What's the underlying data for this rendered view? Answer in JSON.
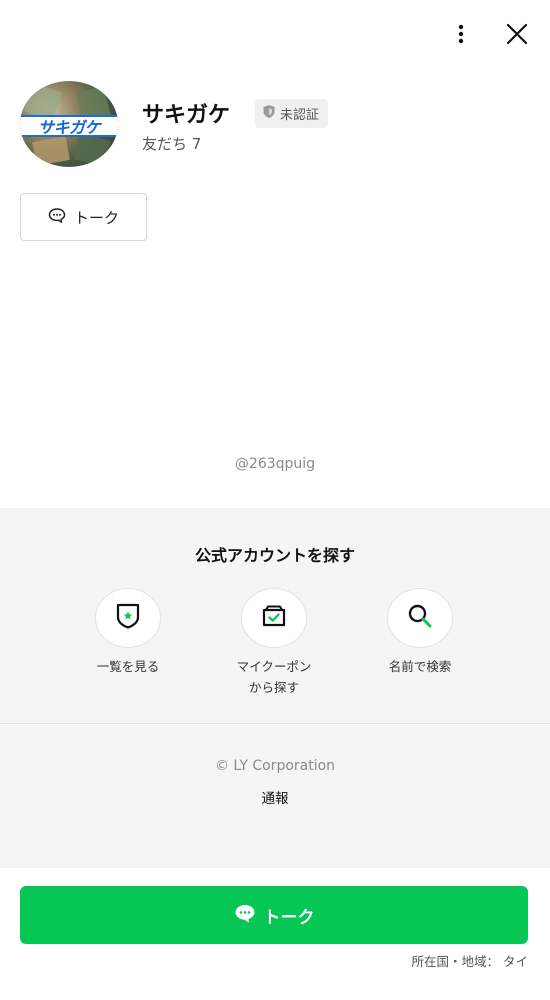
{
  "profile": {
    "name": "サキガケ",
    "verification_badge": "未認証",
    "friends_count": "友だち 7",
    "avatar_logo_text": "サキガケ"
  },
  "actions": {
    "talk_small_label": "トーク",
    "talk_main_label": "トーク"
  },
  "handle": "@263qpuig",
  "discover": {
    "title": "公式アカウントを探す",
    "options": [
      {
        "label": "一覧を見る",
        "icon": "shield-star-icon"
      },
      {
        "label_line1": "マイクーポン",
        "label_line2": "から探す",
        "icon": "coupon-icon"
      },
      {
        "label": "名前で検索",
        "icon": "search-icon"
      }
    ]
  },
  "footer": {
    "copyright": "© LY Corporation",
    "report": "通報",
    "country": "所在国・地域： タイ"
  },
  "colors": {
    "brand_green": "#06c755",
    "logo_blue": "#1565d8"
  }
}
